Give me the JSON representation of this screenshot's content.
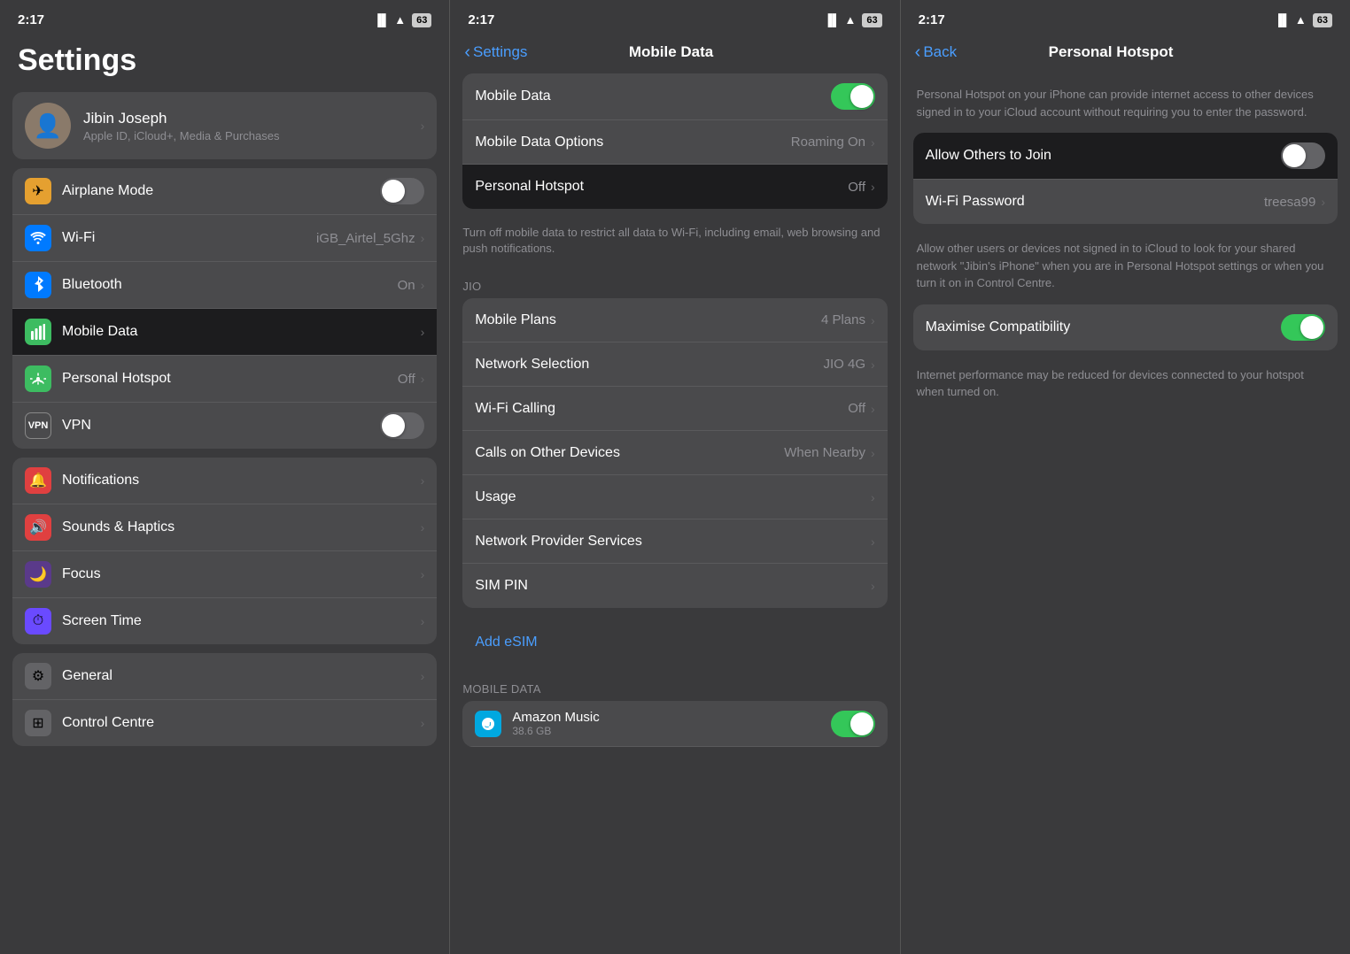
{
  "panel1": {
    "statusBar": {
      "time": "2:17",
      "signal": "●●●○",
      "wifi": "WiFi",
      "battery": "63"
    },
    "title": "Settings",
    "profile": {
      "name": "Jibin Joseph",
      "subtitle": "Apple ID, iCloud+, Media & Purchases"
    },
    "groups": [
      {
        "id": "network",
        "items": [
          {
            "id": "airplane",
            "icon": "✈",
            "iconBg": "#e5a030",
            "label": "Airplane Mode",
            "type": "toggle",
            "toggleOn": false
          },
          {
            "id": "wifi",
            "icon": "📶",
            "iconBg": "#007aff",
            "label": "Wi-Fi",
            "value": "iGB_Airtel_5Ghz",
            "type": "nav"
          },
          {
            "id": "bluetooth",
            "icon": "🔷",
            "iconBg": "#007aff",
            "label": "Bluetooth",
            "value": "On",
            "type": "nav"
          },
          {
            "id": "mobile-data",
            "icon": "📡",
            "iconBg": "#3dbc61",
            "label": "Mobile Data",
            "type": "nav",
            "selected": true
          },
          {
            "id": "hotspot",
            "icon": "📶",
            "iconBg": "#3dbc61",
            "label": "Personal Hotspot",
            "value": "Off",
            "type": "nav"
          },
          {
            "id": "vpn",
            "icon": "VPN",
            "iconBg": "#4a4a4c",
            "label": "VPN",
            "type": "toggle",
            "toggleOn": false
          }
        ]
      },
      {
        "id": "notifications",
        "items": [
          {
            "id": "notifications",
            "icon": "🔔",
            "iconBg": "#e04040",
            "label": "Notifications",
            "type": "nav"
          },
          {
            "id": "sounds",
            "icon": "🔊",
            "iconBg": "#e04040",
            "label": "Sounds & Haptics",
            "type": "nav"
          },
          {
            "id": "focus",
            "icon": "🌙",
            "iconBg": "#5a3a8a",
            "label": "Focus",
            "type": "nav"
          },
          {
            "id": "screentime",
            "icon": "⏱",
            "iconBg": "#6a4aff",
            "label": "Screen Time",
            "type": "nav"
          }
        ]
      },
      {
        "id": "general",
        "items": [
          {
            "id": "general",
            "icon": "⚙",
            "iconBg": "#636366",
            "label": "General",
            "type": "nav"
          },
          {
            "id": "control",
            "icon": "⚙",
            "iconBg": "#636366",
            "label": "Control Centre",
            "type": "nav"
          }
        ]
      }
    ]
  },
  "panel2": {
    "statusBar": {
      "time": "2:17",
      "signal": "●●●○",
      "wifi": "WiFi",
      "battery": "63"
    },
    "navBack": "Settings",
    "navTitle": "Mobile Data",
    "sections": [
      {
        "id": "top",
        "items": [
          {
            "id": "mobile-data-toggle",
            "label": "Mobile Data",
            "type": "toggle",
            "toggleOn": true
          },
          {
            "id": "mobile-data-options",
            "label": "Mobile Data Options",
            "value": "Roaming On",
            "type": "nav"
          },
          {
            "id": "personal-hotspot",
            "label": "Personal Hotspot",
            "value": "Off",
            "type": "nav",
            "selected": false
          }
        ],
        "footer": "Turn off mobile data to restrict all data to Wi-Fi, including email, web browsing and push notifications."
      },
      {
        "id": "jio",
        "header": "JIO",
        "items": [
          {
            "id": "mobile-plans",
            "label": "Mobile Plans",
            "value": "4 Plans",
            "type": "nav"
          },
          {
            "id": "network-selection",
            "label": "Network Selection",
            "value": "JIO 4G",
            "type": "nav"
          },
          {
            "id": "wifi-calling",
            "label": "Wi-Fi Calling",
            "value": "Off",
            "type": "nav"
          },
          {
            "id": "calls-other",
            "label": "Calls on Other Devices",
            "value": "When Nearby",
            "type": "nav"
          },
          {
            "id": "usage",
            "label": "Usage",
            "type": "nav"
          },
          {
            "id": "network-provider",
            "label": "Network Provider Services",
            "type": "nav"
          },
          {
            "id": "sim-pin",
            "label": "SIM PIN",
            "type": "nav"
          }
        ]
      },
      {
        "id": "esim",
        "link": "Add eSIM"
      },
      {
        "id": "mobile-data-apps",
        "header": "MOBILE DATA",
        "items": [
          {
            "id": "amazon-music",
            "label": "Amazon Music",
            "size": "38.6 GB",
            "type": "toggle",
            "toggleOn": true
          }
        ]
      }
    ]
  },
  "panel3": {
    "statusBar": {
      "time": "2:17",
      "signal": "●●●○",
      "wifi": "WiFi",
      "battery": "63"
    },
    "navBack": "Back",
    "navTitle": "Personal Hotspot",
    "description": "Personal Hotspot on your iPhone can provide internet access to other devices signed in to your iCloud account without requiring you to enter the password.",
    "settings": [
      {
        "id": "allow-others",
        "label": "Allow Others to Join",
        "type": "toggle",
        "toggleOn": false,
        "selected": true
      },
      {
        "id": "wifi-password",
        "label": "Wi-Fi Password",
        "value": "treesa99",
        "type": "nav"
      }
    ],
    "footer": "Allow other users or devices not signed in to iCloud to look for your shared network \"Jibin's iPhone\" when you are in Personal Hotspot settings or when you turn it on in Control Centre.",
    "compatibility": [
      {
        "id": "maximise-compat",
        "label": "Maximise Compatibility",
        "type": "toggle",
        "toggleOn": true
      }
    ],
    "compatFooter": "Internet performance may be reduced for devices connected to your hotspot when turned on."
  }
}
